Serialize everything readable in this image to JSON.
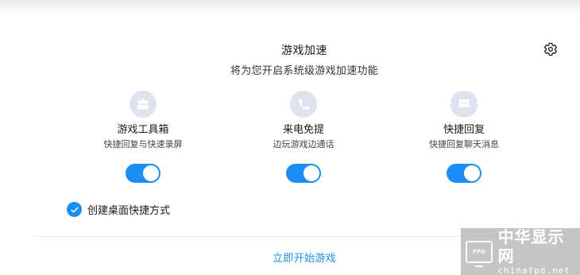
{
  "header": {
    "title": "游戏加速",
    "subtitle": "将为您开启系统级游戏加速功能",
    "settings_icon": "gear-icon"
  },
  "features": [
    {
      "icon": "toolbox-icon",
      "name": "游戏工具箱",
      "desc": "快捷回复与快速录屏",
      "enabled": true
    },
    {
      "icon": "phone-icon",
      "name": "来电免提",
      "desc": "边玩游戏边通话",
      "enabled": true
    },
    {
      "icon": "chat-bubble-icon",
      "name": "快捷回复",
      "desc": "快捷回复聊天消息",
      "enabled": true
    }
  ],
  "shortcut": {
    "label": "创建桌面快捷方式",
    "checked": true
  },
  "footer": {
    "start_label": "立即开始游戏"
  },
  "watermark": {
    "logo_text": "FPD",
    "text_cn": "中华显示网",
    "text_en": "chinafpd.net"
  },
  "colors": {
    "accent": "#1a8ef5",
    "icon_bg": "#dfe3ef"
  }
}
